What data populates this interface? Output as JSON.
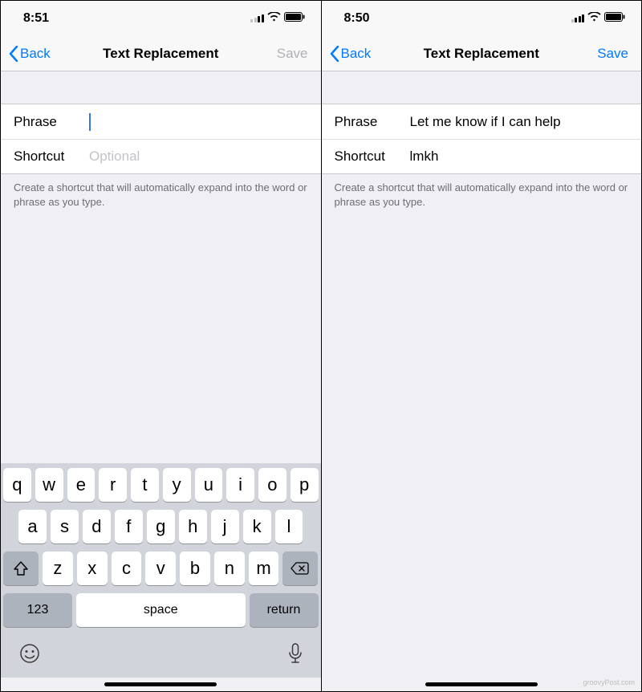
{
  "left": {
    "status": {
      "time": "8:51"
    },
    "nav": {
      "back": "Back",
      "title": "Text Replacement",
      "save": "Save",
      "save_enabled": false
    },
    "form": {
      "phrase_label": "Phrase",
      "phrase_value": "",
      "phrase_placeholder": "",
      "shortcut_label": "Shortcut",
      "shortcut_value": "",
      "shortcut_placeholder": "Optional"
    },
    "hint": "Create a shortcut that will automatically expand into the word or phrase as you type.",
    "keyboard": {
      "row1": [
        "q",
        "w",
        "e",
        "r",
        "t",
        "y",
        "u",
        "i",
        "o",
        "p"
      ],
      "row2": [
        "a",
        "s",
        "d",
        "f",
        "g",
        "h",
        "j",
        "k",
        "l"
      ],
      "row3": [
        "z",
        "x",
        "c",
        "v",
        "b",
        "n",
        "m"
      ],
      "num": "123",
      "space": "space",
      "return": "return"
    }
  },
  "right": {
    "status": {
      "time": "8:50"
    },
    "nav": {
      "back": "Back",
      "title": "Text Replacement",
      "save": "Save",
      "save_enabled": true
    },
    "form": {
      "phrase_label": "Phrase",
      "phrase_value": "Let me know if I can help",
      "phrase_placeholder": "",
      "shortcut_label": "Shortcut",
      "shortcut_value": "lmkh",
      "shortcut_placeholder": "Optional"
    },
    "hint": "Create a shortcut that will automatically expand into the word or phrase as you type."
  },
  "watermark": "groovyPost.com"
}
